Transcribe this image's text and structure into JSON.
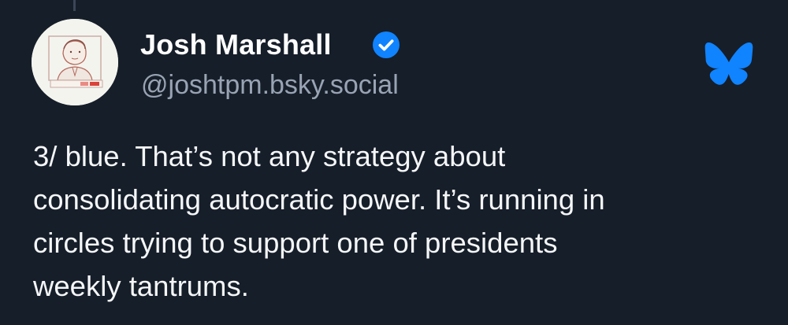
{
  "author": {
    "display_name": "Josh Marshall",
    "handle": "@joshtpm.bsky.social",
    "verified": true,
    "avatar_icon": "cartoon-portrait-avatar"
  },
  "post": {
    "text": "3/ blue. That’s not any strategy about\nconsolidating autocratic power. It’s running in\ncircles trying to support one of presidents\nweekly tantrums."
  },
  "icons": {
    "verified": "verified-badge-icon",
    "platform": "bluesky-butterfly-icon"
  },
  "colors": {
    "background": "#161e29",
    "text": "#f4f6f8",
    "handle": "#98a3b3",
    "accent": "#1083fe"
  }
}
